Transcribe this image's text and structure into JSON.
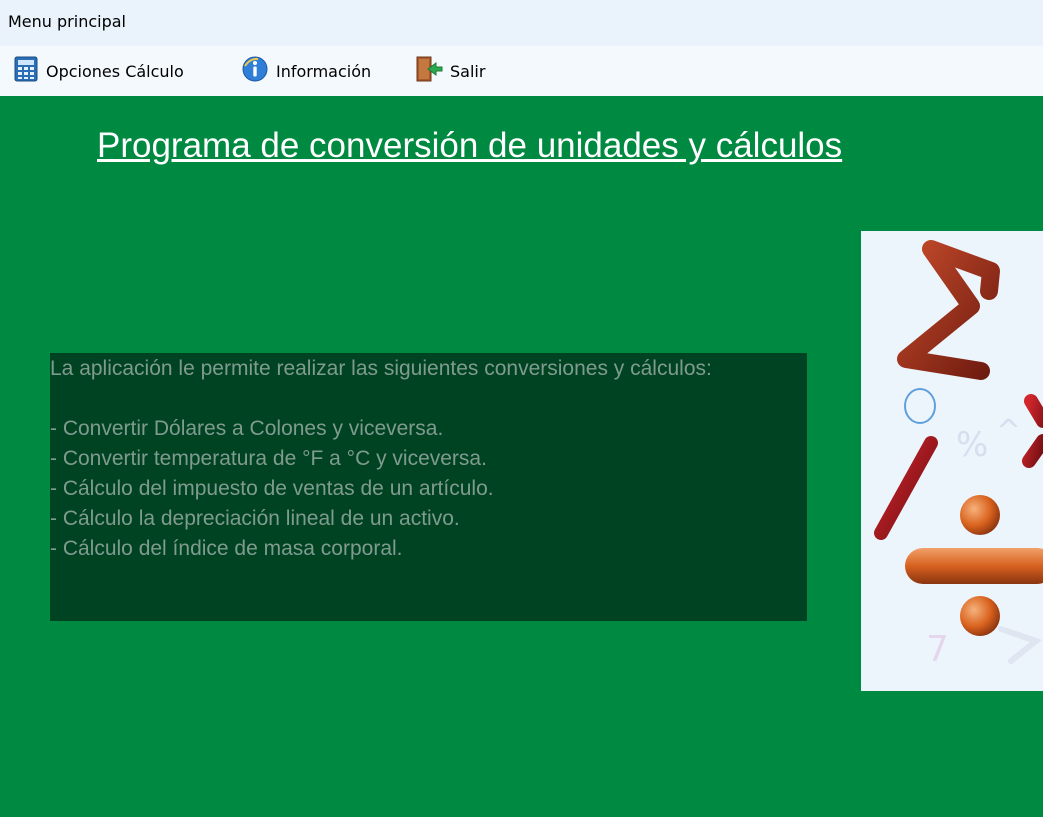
{
  "window": {
    "title": "Menu principal"
  },
  "menu": {
    "items": [
      {
        "label": "Opciones Cálculo",
        "icon": "calculator-icon"
      },
      {
        "label": "Información",
        "icon": "info-icon"
      },
      {
        "label": "Salir",
        "icon": "exit-door-icon"
      }
    ]
  },
  "main": {
    "heading": "Programa de conversión de unidades y cálculos",
    "description": {
      "intro": "La aplicación le permite realizar las siguientes conversiones y cálculos:",
      "items": [
        "- Convertir Dólares a Colones y viceversa.",
        "- Convertir temperatura de °F a °C y viceversa.",
        "- Cálculo del impuesto de ventas de un artículo.",
        "- Cálculo la depreciación lineal de un activo.",
        "- Cálculo del índice de masa corporal."
      ]
    }
  },
  "colors": {
    "background": "#008a41",
    "info_box": "#004322",
    "info_text": "#7f9b8e",
    "heading": "#ffffff"
  }
}
